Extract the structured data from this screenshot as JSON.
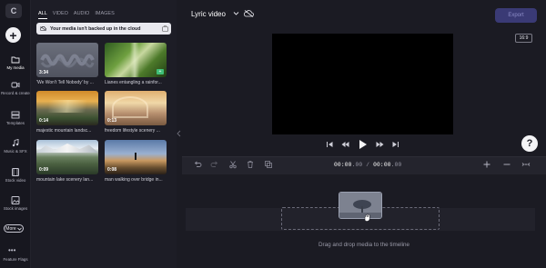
{
  "sidebar": {
    "logo": "C",
    "create_symbol": "+",
    "items": [
      {
        "label": "My media",
        "icon": "folder-icon"
      },
      {
        "label": "Record & create",
        "icon": "camera-icon"
      },
      {
        "label": "Templates",
        "icon": "templates-icon"
      },
      {
        "label": "Music & SFX",
        "icon": "music-note-icon"
      },
      {
        "label": "Stock video",
        "icon": "film-icon"
      },
      {
        "label": "Stock images",
        "icon": "image-icon"
      }
    ],
    "more_label": "More",
    "feature_flags_label": "Feature Flags",
    "dots": "•••"
  },
  "media_panel": {
    "tabs": [
      "ALL",
      "VIDEO",
      "AUDIO",
      "IMAGES"
    ],
    "notice": "Your media isn't backed up in the cloud",
    "items": [
      {
        "title": "'We Won't Tell Nobody' by ...",
        "duration": "3:34"
      },
      {
        "title": "Lianes entangling a rainfor...",
        "duration": ""
      },
      {
        "title": "majestic mountain landsc...",
        "duration": "0:14"
      },
      {
        "title": "freedom lifestyle scenery ...",
        "duration": "0:13"
      },
      {
        "title": "mountain lake scenery lan...",
        "duration": "0:09"
      },
      {
        "title": "man walking over bridge in...",
        "duration": "0:08"
      }
    ]
  },
  "header": {
    "project_title": "Lyric video",
    "export_label": "Export",
    "aspect_ratio": "16:9"
  },
  "timeline": {
    "timecode_current": "00:00",
    "timecode_current_frac": ".00",
    "timecode_separator": " / ",
    "timecode_total": "00:00",
    "timecode_total_frac": ".00",
    "drop_hint": "Drag and drop media to the timeline"
  },
  "help_label": "?",
  "colors": {
    "background": "#1b1b23",
    "export_button": "#3a3a75",
    "media_add_badge": "#3fbf78"
  }
}
